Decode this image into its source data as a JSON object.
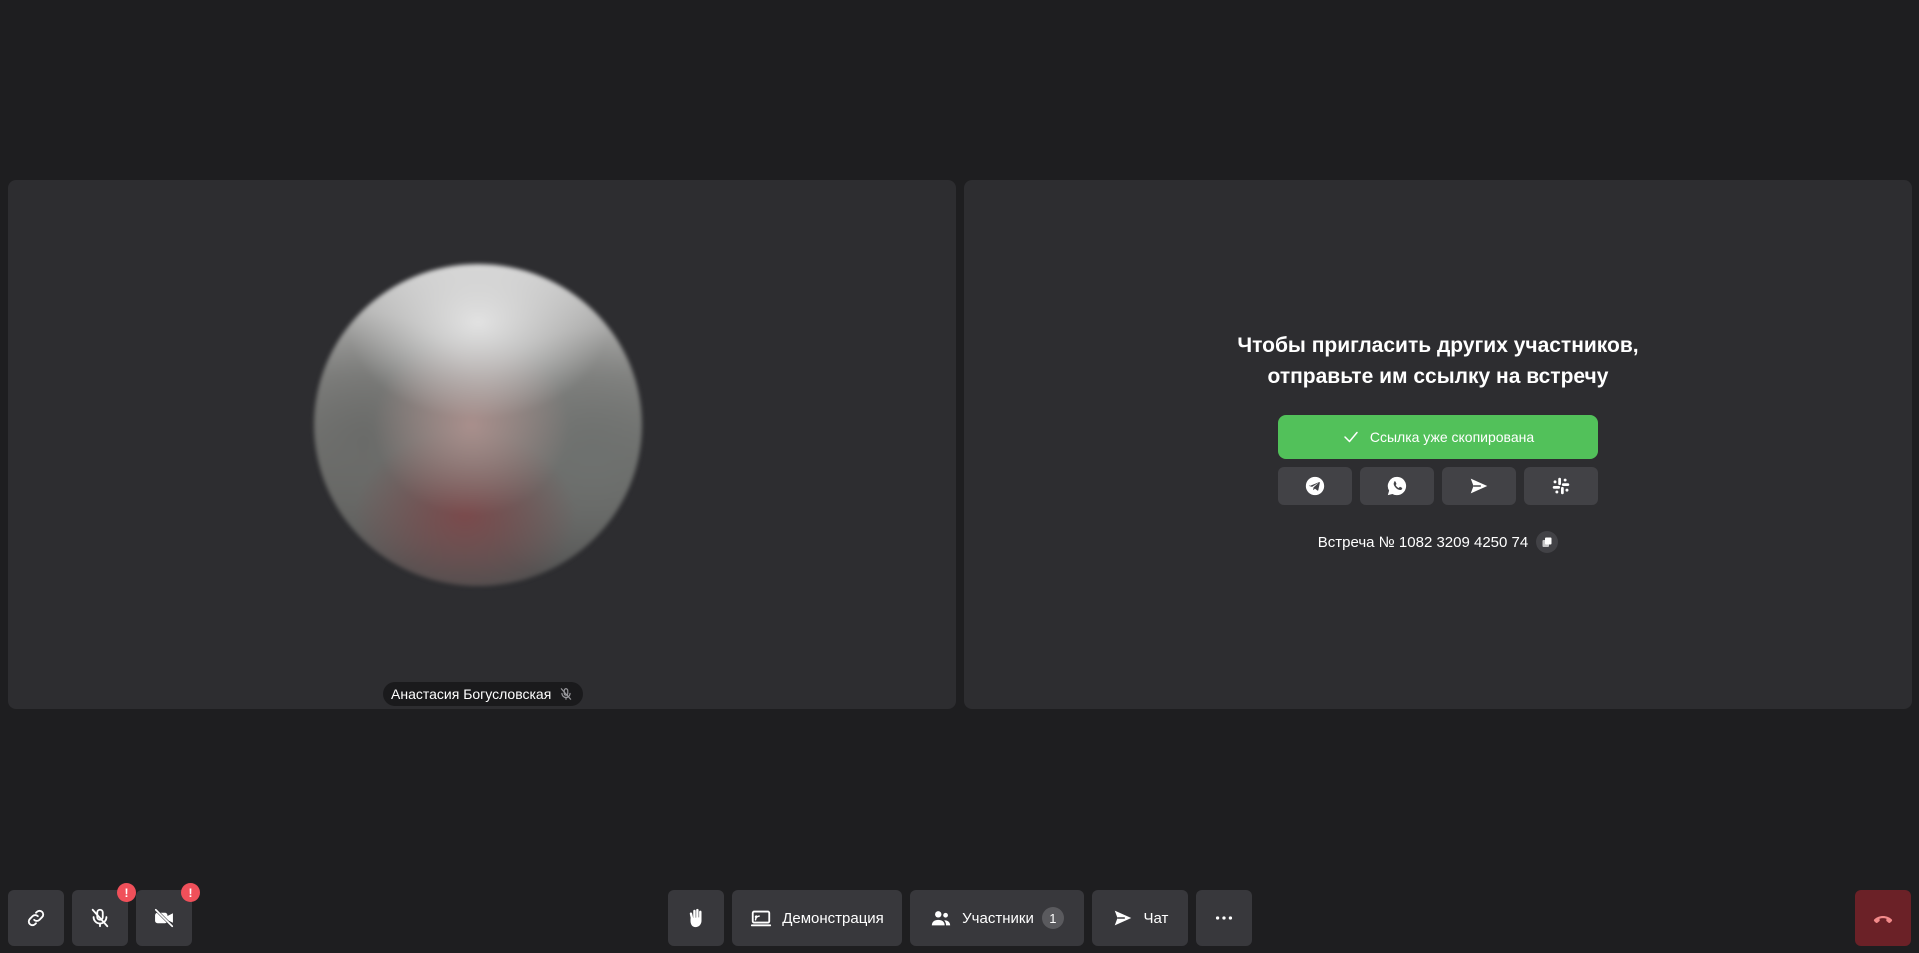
{
  "participant": {
    "name": "Анастасия Богусловская"
  },
  "invite": {
    "title_line1": "Чтобы пригласить других участников,",
    "title_line2": "отправьте им ссылку на встречу",
    "copied_label": "Ссылка уже скопирована",
    "share_targets": [
      "telegram-icon",
      "whatsapp-icon",
      "send-icon",
      "slack-icon"
    ],
    "meeting_label": "Встреча № 1082 3209 4250 74"
  },
  "toolbar": {
    "mic_alert": "!",
    "camera_alert": "!",
    "demo_label": "Демонстрация",
    "participants_label": "Участники",
    "participants_count": "1",
    "chat_label": "Чат"
  },
  "colors": {
    "background": "#1e1e20",
    "tile": "#2d2d30",
    "accent_green": "#52c15a",
    "alert_red": "#f0505a",
    "end_call": "#6b2127"
  }
}
